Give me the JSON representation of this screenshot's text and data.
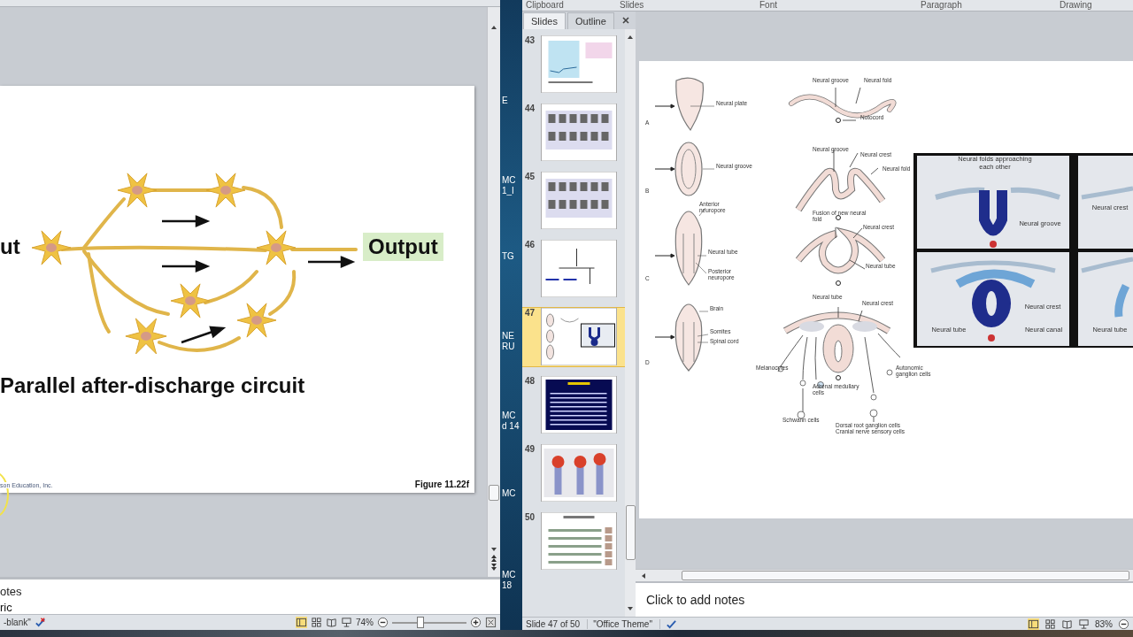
{
  "left_window": {
    "slide": {
      "input_label": "ut",
      "output_label": "Output",
      "title": "Parallel after-discharge circuit",
      "credit": "son Education, Inc.",
      "figure_number": "Figure 11.22f"
    },
    "notes": "otes",
    "ribbon_fragment": "ric",
    "status_bar": {
      "theme": "-blank\"",
      "zoom": "74%",
      "zoom_slider": {
        "level": 0.37
      }
    }
  },
  "desktop": {
    "icon_labels": [
      {
        "lines": [
          "E"
        ]
      },
      {
        "lines": [
          "MC",
          "1_I"
        ]
      },
      {
        "lines": [
          "TG"
        ]
      },
      {
        "lines": [
          "NE",
          "RU"
        ]
      },
      {
        "lines": [
          "MC",
          "d 14"
        ]
      },
      {
        "lines": [
          "MC"
        ]
      },
      {
        "lines": [
          "MC",
          "18"
        ]
      }
    ]
  },
  "right_window": {
    "ribbon_groups": [
      "Clipboard",
      "Slides",
      "Font",
      "Paragraph",
      "Drawing"
    ],
    "slides_panel": {
      "tabs": [
        {
          "label": "Slides",
          "selected": true
        },
        {
          "label": "Outline",
          "selected": false
        }
      ],
      "thumbnails": [
        {
          "number": "43",
          "kind": "graph",
          "selected": false
        },
        {
          "number": "44",
          "kind": "table",
          "selected": false
        },
        {
          "number": "45",
          "kind": "table",
          "selected": false
        },
        {
          "number": "46",
          "kind": "flow",
          "selected": false
        },
        {
          "number": "47",
          "kind": "embryo",
          "selected": true
        },
        {
          "number": "48",
          "kind": "dark",
          "selected": false
        },
        {
          "number": "49",
          "kind": "photo",
          "selected": false
        },
        {
          "number": "50",
          "kind": "diagram",
          "selected": false
        }
      ]
    },
    "slide": {
      "figure_labels": [
        "Neural plate",
        "Neural groove",
        "Neural fold",
        "Notocord",
        "A",
        "Neural groove",
        "Neural groove",
        "Neural crest",
        "Neural fold",
        "B",
        "Anterior neuropore",
        "Fusion of new neural fold",
        "Neural crest",
        "Neural tube",
        "Posterior neuropore",
        "Neural tube",
        "C",
        "Neural tube",
        "Neural crest",
        "Brain",
        "Somites",
        "Spinal cord",
        "D",
        "Melanocytes",
        "Autonomic ganglion cells",
        "Adrenal medullary cells",
        "Schwann cells",
        "Dorsal root ganglion cells",
        "Cranial nerve sensory cells"
      ],
      "panel_labels": [
        "Neural folds approaching each other",
        "Neural groove",
        "Neural crest",
        "Neural crest",
        "Neural tube",
        "Neural canal",
        "Neural tube"
      ]
    },
    "notes_placeholder": "Click to add notes",
    "status_bar": {
      "slide_position": "Slide 47 of 50",
      "theme": "\"Office Theme\"",
      "zoom": "83%"
    }
  }
}
